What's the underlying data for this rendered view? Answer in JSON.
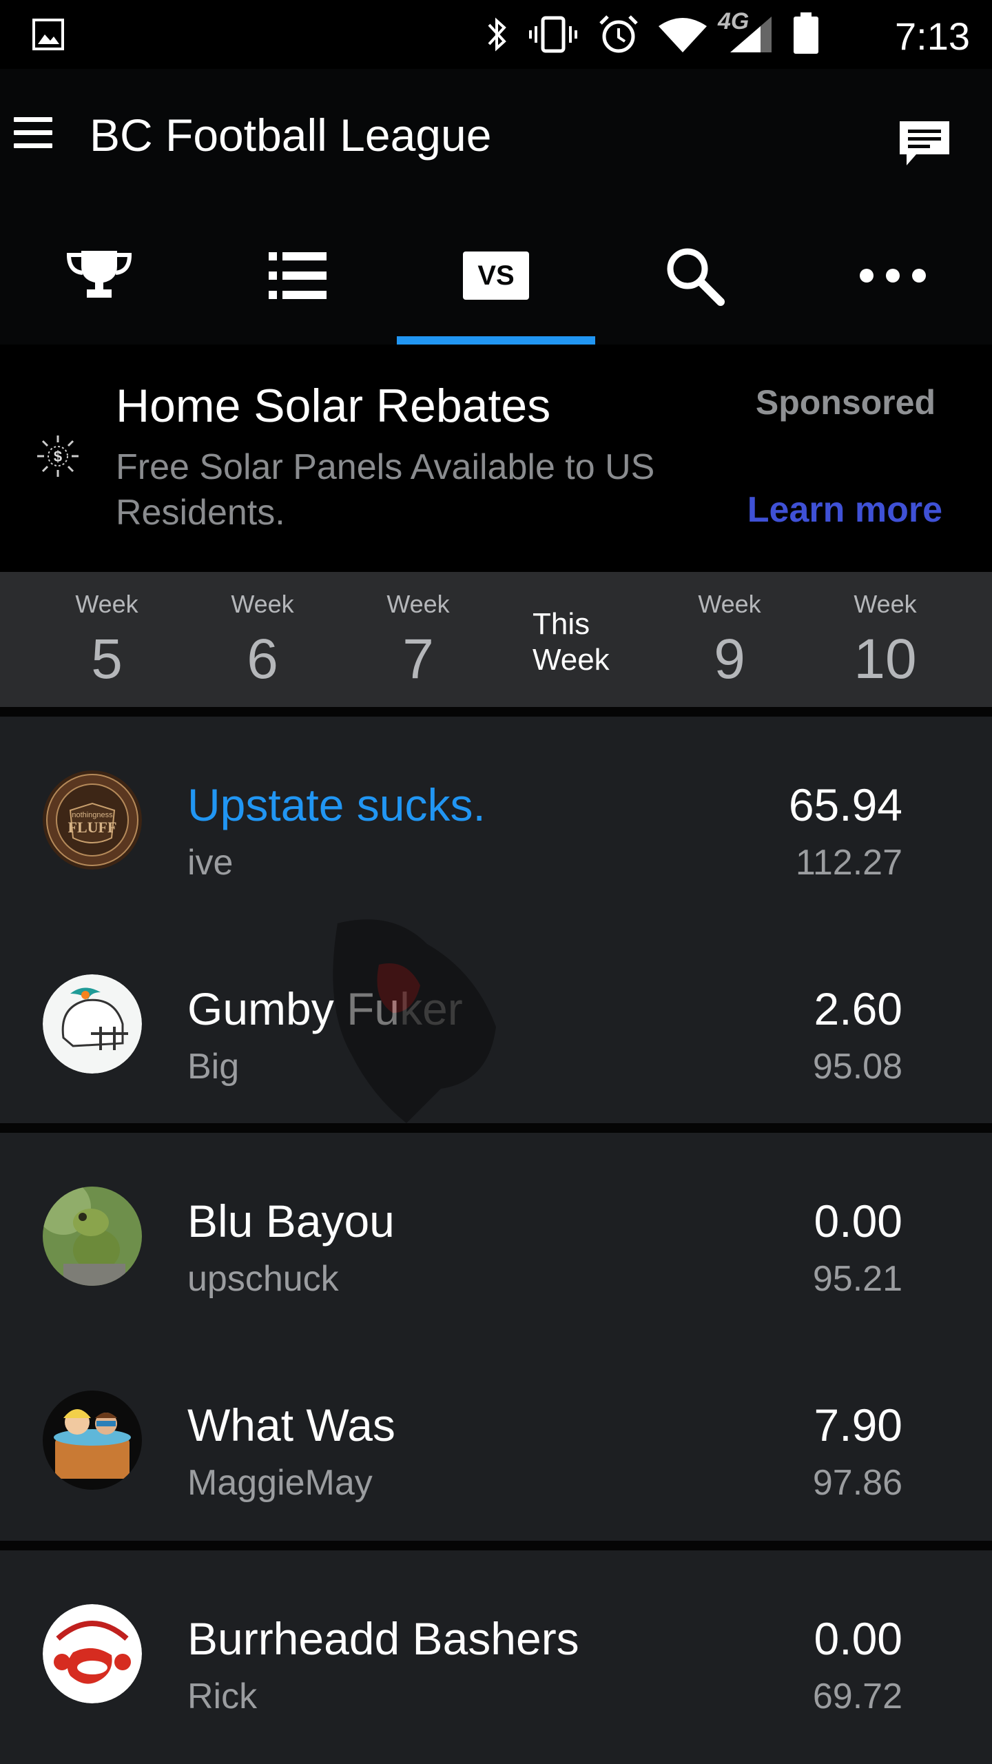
{
  "status_bar": {
    "time": "7:13",
    "network": "4G",
    "icons": [
      "gallery-icon",
      "bluetooth-icon",
      "vibrate-icon",
      "alarm-icon",
      "wifi-icon",
      "signal-icon",
      "battery-icon"
    ]
  },
  "app_bar": {
    "title": "BC Football League"
  },
  "tabs": [
    {
      "icon": "trophy-icon"
    },
    {
      "icon": "list-icon"
    },
    {
      "icon": "vs-icon",
      "label": "VS",
      "selected": true
    },
    {
      "icon": "search-icon"
    },
    {
      "icon": "more-icon"
    }
  ],
  "ad": {
    "title": "Home Solar Rebates",
    "description": "Free Solar Panels Available to US Residents.",
    "sponsored": "Sponsored",
    "cta": "Learn more"
  },
  "weeks": [
    {
      "label": "Week",
      "number": "5"
    },
    {
      "label": "Week",
      "number": "6"
    },
    {
      "label": "Week",
      "number": "7"
    },
    {
      "label": "This Week",
      "current": true
    },
    {
      "label": "Week",
      "number": "9"
    },
    {
      "label": "Week",
      "number": "10"
    }
  ],
  "matchups": [
    {
      "team": "Upstate sucks.",
      "owner": "ive",
      "score": "65.94",
      "projected": "112.27",
      "highlight": true,
      "avatar": "fluff-logo"
    },
    {
      "team": "Gumby Fu",
      "team_rest": "ker",
      "owner": "Big",
      "score": "2.60",
      "projected": "95.08",
      "avatar": "dolphins-helmet"
    },
    {
      "team": "Blu Bayou",
      "owner": "upschuck",
      "score": "0.00",
      "projected": "95.21",
      "avatar": "frog-photo"
    },
    {
      "team": "What Was",
      "owner": "MaggieMay",
      "score": "7.90",
      "projected": "97.86",
      "avatar": "hot-tub-cartoon"
    },
    {
      "team": "Burrheadd Bashers",
      "owner": "Rick",
      "score": "0.00",
      "projected": "69.72",
      "avatar": "crawfish-logo"
    }
  ],
  "colors": {
    "accent": "#2196f3",
    "ad_link": "#3f51d6",
    "background": "#1d1f22"
  }
}
